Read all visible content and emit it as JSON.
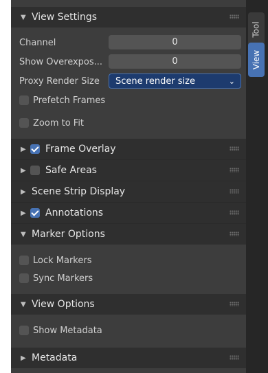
{
  "tabs": {
    "tool": "Tool",
    "view": "View"
  },
  "view_settings": {
    "title": "View Settings",
    "channel_label": "Channel",
    "channel_value": "0",
    "overexposed_label": "Show Overexpos...",
    "overexposed_value": "0",
    "proxy_label": "Proxy Render Size",
    "proxy_value": "Scene render size",
    "prefetch_label": "Prefetch Frames",
    "zoom_label": "Zoom to Fit"
  },
  "panels": {
    "frame_overlay": "Frame Overlay",
    "safe_areas": "Safe Areas",
    "scene_strip": "Scene Strip Display",
    "annotations": "Annotations",
    "marker_options": "Marker Options",
    "lock_markers": "Lock Markers",
    "sync_markers": "Sync Markers",
    "view_options": "View Options",
    "show_metadata": "Show Metadata",
    "metadata": "Metadata"
  },
  "state": {
    "frame_overlay_checked": true,
    "safe_areas_checked": false,
    "annotations_checked": true,
    "prefetch_checked": false,
    "zoom_checked": false,
    "lock_markers_checked": false,
    "sync_markers_checked": false,
    "show_metadata_checked": false
  },
  "colors": {
    "accent": "#4772b3",
    "panel_bg": "#3d3d3d",
    "header_bg": "#2f2f2f"
  }
}
